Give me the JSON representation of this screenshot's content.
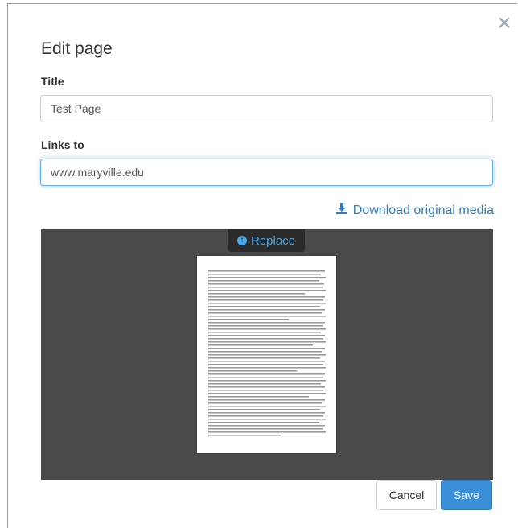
{
  "dialog": {
    "title": "Edit page",
    "close_icon": "close-icon",
    "title_field": {
      "label": "Title",
      "value": "Test Page"
    },
    "links_field": {
      "label": "Links to",
      "value": "www.maryville.edu"
    },
    "download_label": "Download original media",
    "replace_label": "Replace",
    "buttons": {
      "cancel": "Cancel",
      "save": "Save"
    }
  },
  "colors": {
    "accent": "#337ab7",
    "save_button": "#3a8fd6",
    "preview_background": "#4a4a4a"
  }
}
